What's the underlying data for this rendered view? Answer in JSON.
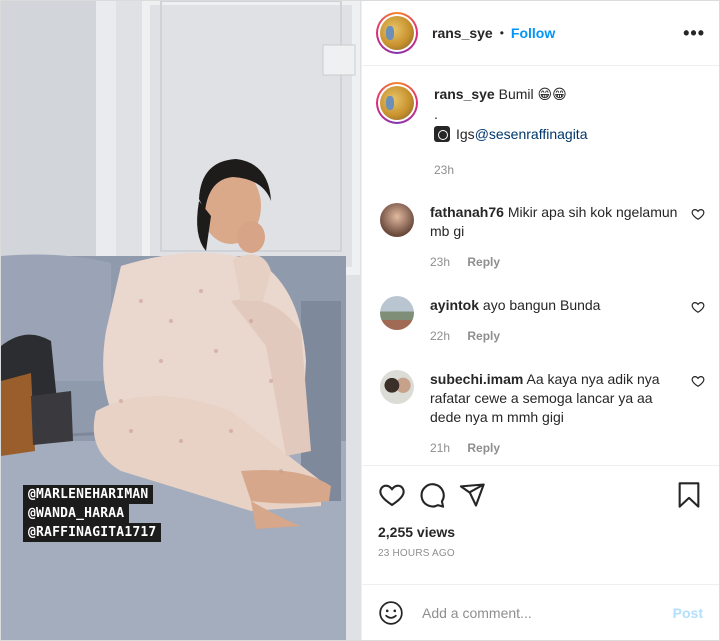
{
  "header": {
    "username": "rans_sye",
    "separator": "•",
    "follow_label": "Follow",
    "more_label": "•••"
  },
  "caption": {
    "username": "rans_sye",
    "text": "Bumil 😁😁",
    "line2": ".",
    "igs_prefix": "Igs ",
    "mention": "@sesenraffinagita",
    "time": "23h"
  },
  "comments": [
    {
      "username": "fathanah76",
      "text": "Mikir apa sih kok ngelamun mb gi",
      "time": "23h",
      "reply_label": "Reply"
    },
    {
      "username": "ayintok",
      "text": "ayo bangun Bunda",
      "time": "22h",
      "reply_label": "Reply"
    },
    {
      "username": "subechi.imam",
      "text": "Aa kaya nya adik nya rafatar cewe a semoga lancar ya aa dede nya m mmh gigi",
      "time": "21h",
      "reply_label": "Reply"
    }
  ],
  "media": {
    "tags": [
      "@MARLENEHARIMAN",
      "@WANDA_HARAA",
      "@RAFFINAGITA1717"
    ]
  },
  "stats": {
    "views": "2,255 views",
    "ago": "23 HOURS AGO"
  },
  "add_comment": {
    "placeholder": "Add a comment...",
    "post_label": "Post"
  },
  "colors": {
    "accent": "#0095f6",
    "muted": "#8e8e8e",
    "post_disabled": "#b2dffc"
  }
}
